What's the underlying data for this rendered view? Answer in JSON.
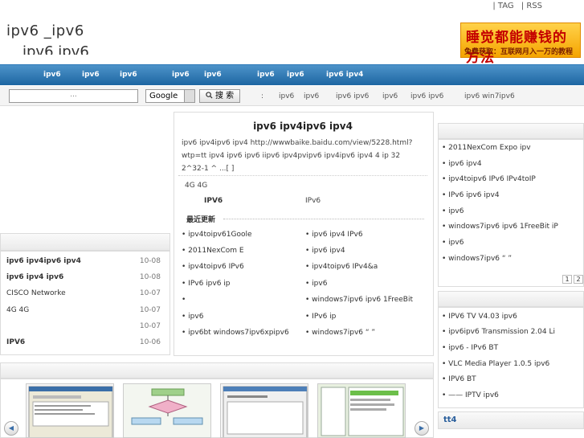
{
  "header": {
    "top_links": [
      "| TAG",
      "| RSS"
    ],
    "title": "ipv6    _ipv6",
    "subtitle": "ipv6          ipv6"
  },
  "ad": {
    "line1": "睡觉都能赚钱的方法",
    "line2": "免费获取：互联网月入一万的教程"
  },
  "nav": {
    "items": [
      "ipv6",
      "ipv6",
      "ipv6",
      "ipv6",
      "ipv6",
      "ipv6",
      "ipv6",
      "ipv6 ipv4"
    ]
  },
  "search": {
    "placeholder": "...",
    "engine": "Google",
    "button": "搜 索",
    "hot_label": ":",
    "hot": [
      "ipv6",
      "ipv6",
      "ipv6  ipv6",
      "ipv6",
      "ipv6  ipv6",
      "ipv6  win7ipv6"
    ]
  },
  "left_list": [
    {
      "title": "ipv6    ipv4ipv6  ipv4",
      "date": "10-08"
    },
    {
      "title": "ipv6          ipv4  ipv6",
      "date": "10-08"
    },
    {
      "title": "        CISCO Networke",
      "date": "10-07"
    },
    {
      "title": "4G         4G",
      "date": "10-07"
    },
    {
      "title": "",
      "date": "10-07"
    },
    {
      "title": "          IPV6",
      "date": "10-06"
    }
  ],
  "article": {
    "title": "ipv6    ipv4ipv6  ipv4",
    "desc": "ipv6  ipv4ipv6 ipv4    http://wwwbaike.baidu.com/view/5228.html?wtp=tt  ipv4   ipv6          ipv6       iipv6  ipv4pvipv6  ipv4ipv6 ipv4   4   ip    32    2^32-1    ^   ...[ ]",
    "line2": "4G       4G",
    "line3": "IPV6",
    "line3b": "IPv6",
    "latest_heading": "最近更新"
  },
  "latest": {
    "left": [
      "ipv4toipv61Goole",
      "         2011NexCom E",
      "ipv4toipv6        IPv6",
      "   IPv6         ipv6   ip",
      "",
      "   ipv6",
      "ipv6bt   windows7ipv6xpipv6"
    ],
    "right": [
      "ipv6  ipv4   IPv6",
      "ipv6   ipv4",
      "ipv4toipv6        IPv4&a",
      "     ipv6",
      "windows7ipv6  ipv6  1FreeBit",
      "          IPv6         ip",
      "windows7ipv6     “  ”"
    ]
  },
  "right_list_1": [
    "         2011NexCom Expo  ipv",
    "ipv6  ipv4",
    "ipv4toipv6      IPv6    IPv4toIP",
    "  IPv6       ipv6  ipv4",
    "  ipv6",
    "windows7ipv6  ipv6  1FreeBit    iP",
    "  ipv6",
    "windows7ipv6     “  ”"
  ],
  "pager": [
    "1",
    "2"
  ],
  "right_list_2": [
    "IPV6 TV     V4.03     ipv6",
    "ipv6ipv6     Transmission 2.04 Li",
    "   ipv6     -    IPv6 BT",
    "VLC Media Player 1.0.5  ipv6",
    "IPV6 BT",
    "        —— IPTV     ipv6"
  ],
  "tt4": "tt4",
  "colors": {
    "nav_top": "#4d93c9",
    "nav_bottom": "#1d66a2",
    "ad_text": "#c40000"
  }
}
